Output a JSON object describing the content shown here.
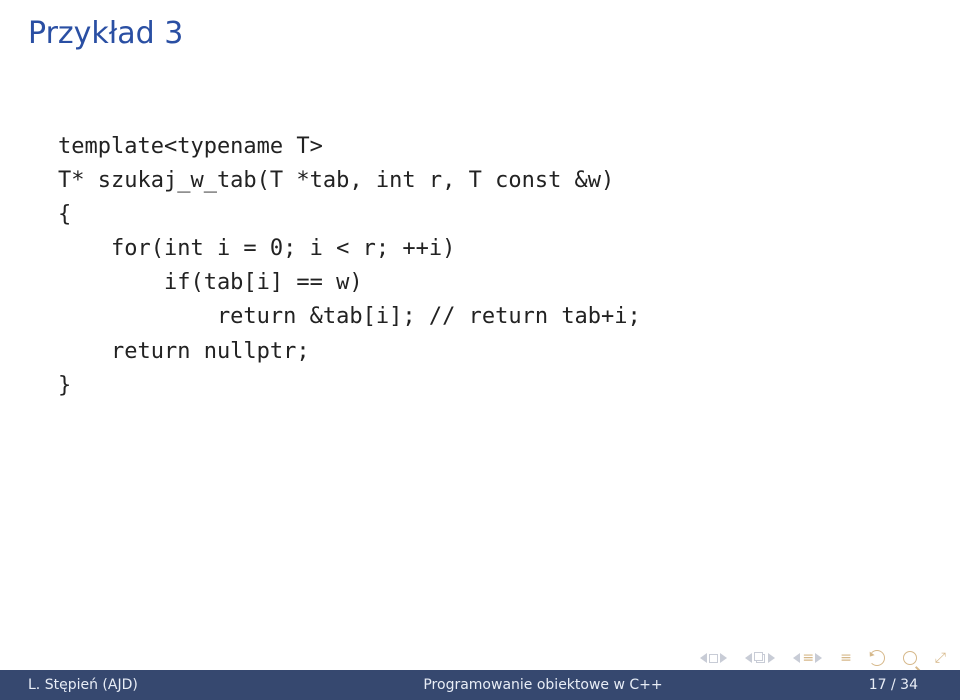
{
  "title": "Przykład 3",
  "code": "template<typename T>\nT* szukaj_w_tab(T *tab, int r, T const &w)\n{\n    for(int i = 0; i < r; ++i)\n        if(tab[i] == w)\n            return &tab[i]; // return tab+i;\n    return nullptr;\n}",
  "footer": {
    "author": "L. Stępień (AJD)",
    "title": "Programowanie obiektowe w C++",
    "pages": "17 / 34"
  }
}
